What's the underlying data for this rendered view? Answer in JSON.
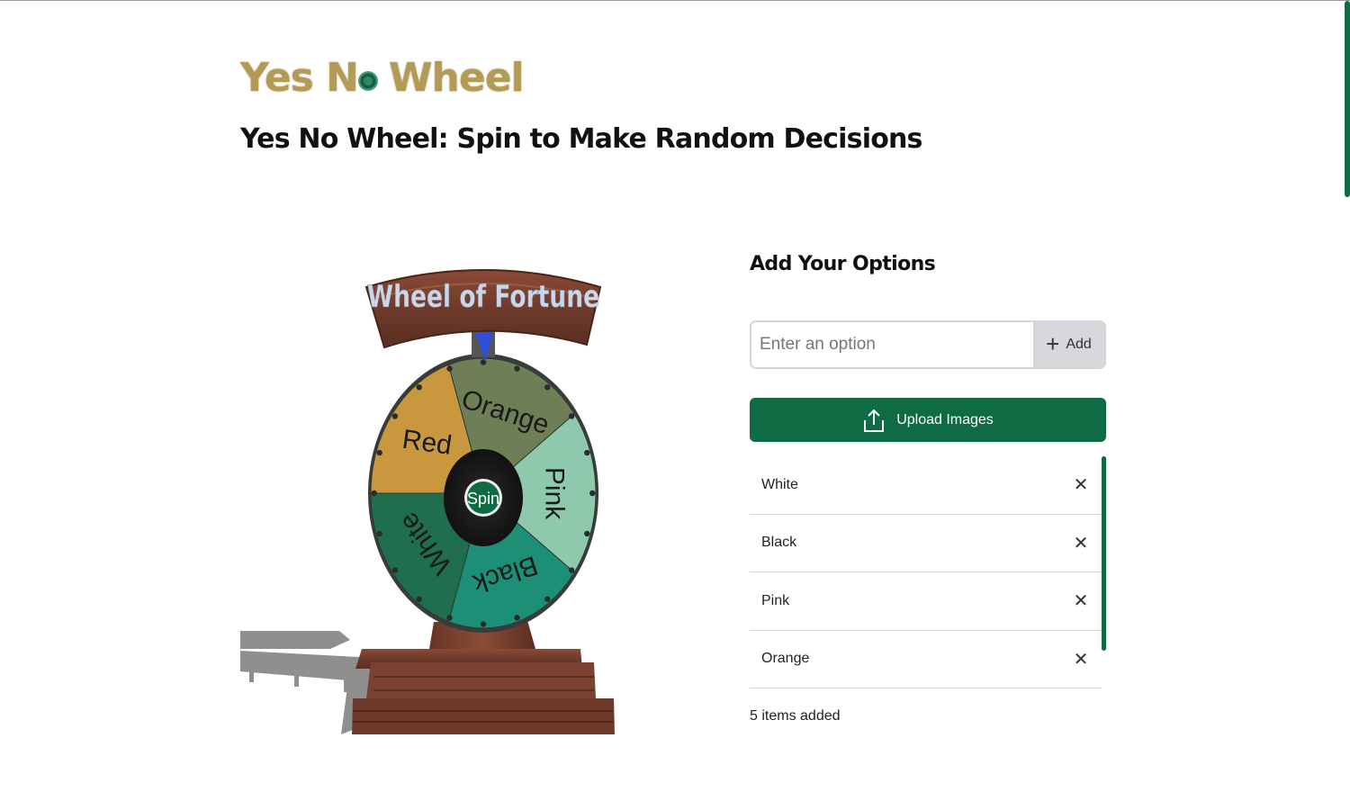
{
  "header": {
    "logo_word_1": "Yes N",
    "logo_word_2": "Wheel",
    "page_title": "Yes No Wheel: Spin to Make Random Decisions"
  },
  "wheel": {
    "banner_text": "Wheel of Fortune",
    "spin_label": "Spin",
    "segments": [
      {
        "label": "Orange",
        "color": "#6f7f55"
      },
      {
        "label": "Pink",
        "color": "#8fc9ad"
      },
      {
        "label": "Black",
        "color": "#1c8f76"
      },
      {
        "label": "White",
        "color": "#1f6e4d"
      },
      {
        "label": "Red",
        "color": "#c9973e"
      }
    ]
  },
  "options": {
    "heading": "Add Your Options",
    "input_placeholder": "Enter an option",
    "add_label": "Add",
    "upload_label": "Upload Images",
    "items": [
      {
        "label": "White"
      },
      {
        "label": "Black"
      },
      {
        "label": "Pink"
      },
      {
        "label": "Orange"
      }
    ],
    "count_text": "5 items added"
  },
  "colors": {
    "brand_green": "#0e6b44",
    "logo_gold": "#b39a55"
  },
  "icons": [
    "plus-icon",
    "upload-icon",
    "close-icon"
  ]
}
